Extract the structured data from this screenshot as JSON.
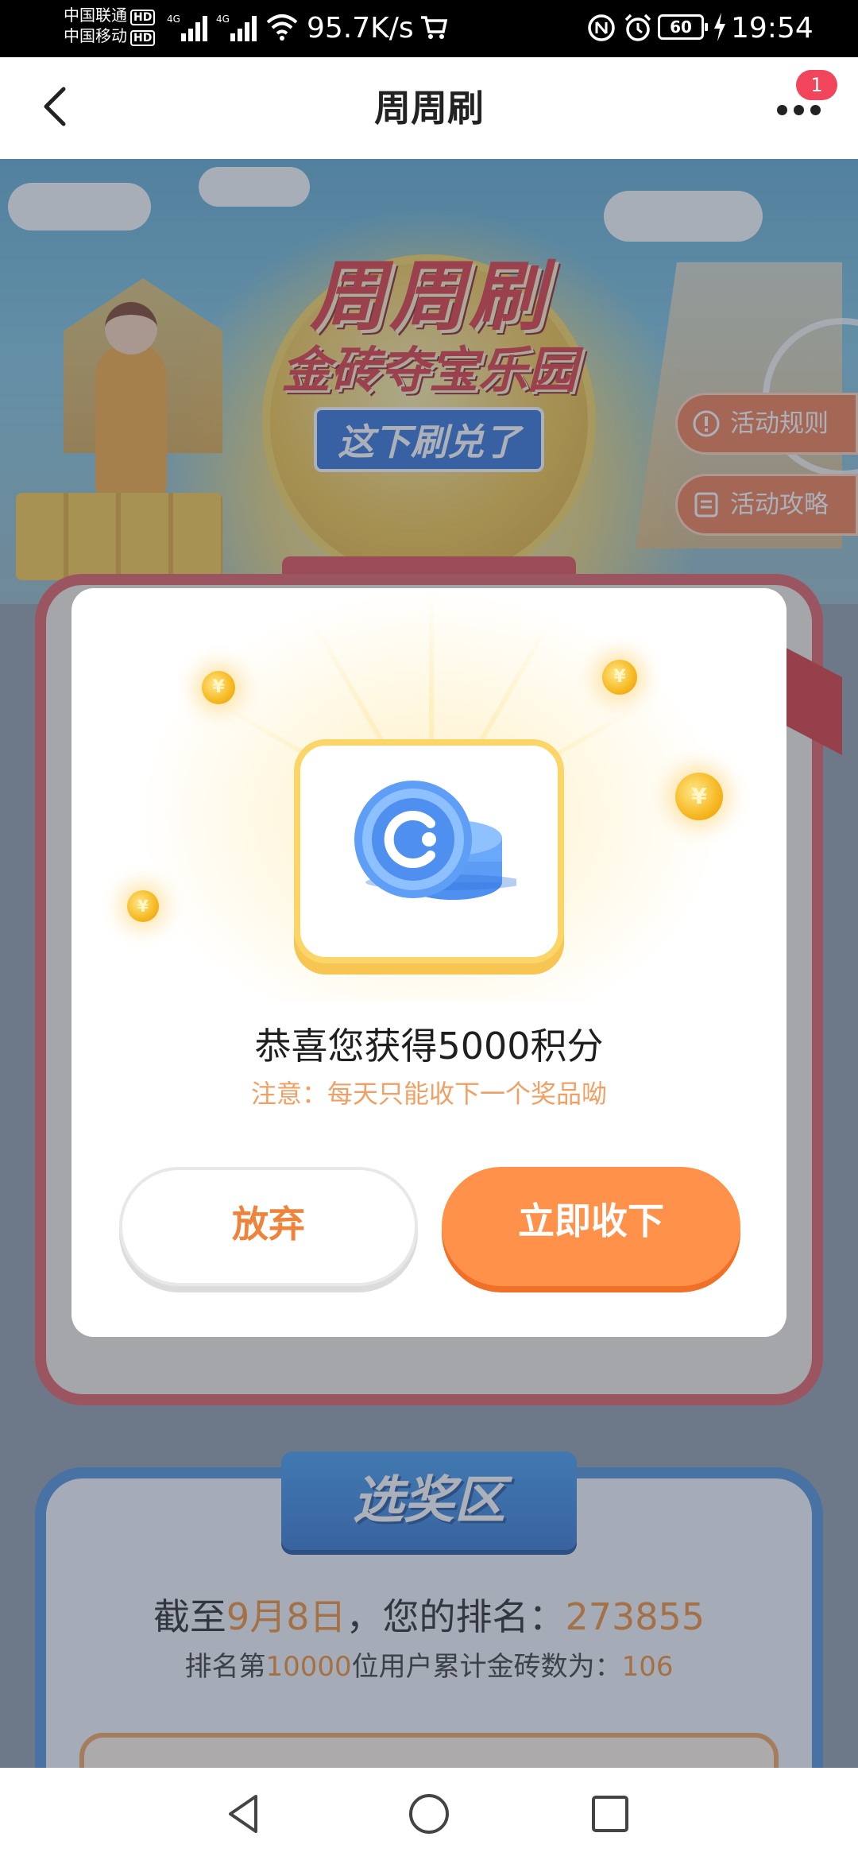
{
  "status_bar": {
    "carrier1": "中国联通",
    "carrier2": "中国移动",
    "hd": "HD",
    "net1": "4G",
    "net2": "4G",
    "net_speed": "95.7K/s",
    "battery": "60",
    "time": "19:54",
    "icons": [
      "signal-icon",
      "wifi-icon",
      "cart-icon",
      "nfc-icon",
      "alarm-icon",
      "battery-icon",
      "charging-icon"
    ]
  },
  "header": {
    "title": "周周刷",
    "badge_count": "1",
    "icons": [
      "back-arrow-icon",
      "more-dots-icon"
    ]
  },
  "banner": {
    "logo_line1": "周周刷",
    "logo_line2": "金砖夺宝乐园",
    "logo_sub": "这下刷兑了",
    "rules_label": "活动规则",
    "guide_label": "活动攻略"
  },
  "modal": {
    "title": "恭喜您获得5000积分",
    "note": "注意：每天只能收下一个奖品呦",
    "give_up_label": "放弃",
    "accept_label": "立即收下",
    "coin_symbol": "¥"
  },
  "prize_section": {
    "title": "选奖区",
    "rank_prefix": "截至",
    "rank_date": "9月8日",
    "rank_middle": "，您的排名：",
    "rank_value": "273855",
    "threshold_prefix": "排名第",
    "threshold_rank": "10000",
    "threshold_middle": "位用户累计金砖数为：",
    "threshold_value": "106"
  },
  "colors": {
    "accent_orange": "#ff914a",
    "note_orange": "#f0a064",
    "badge_red": "#f0455b",
    "section_blue": "#4a8fd9"
  }
}
